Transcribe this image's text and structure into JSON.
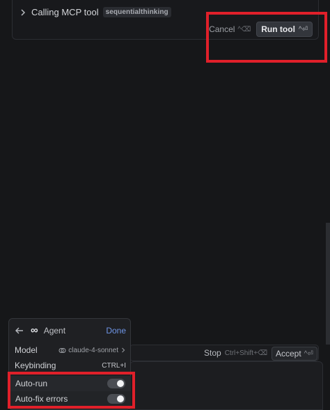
{
  "tool_call": {
    "title": "Calling MCP tool",
    "tool_name": "sequentialthinking",
    "cancel_label": "Cancel",
    "cancel_shortcut": "^⌫",
    "run_label": "Run tool",
    "run_shortcut": "^⏎"
  },
  "composer_bar": {
    "stop_label": "Stop",
    "stop_shortcut": "Ctrl+Shift+⌫",
    "accept_label": "Accept",
    "accept_shortcut": "^⏎"
  },
  "agent_menu": {
    "mode_icon": "∞",
    "mode_label": "Agent",
    "done_label": "Done",
    "model_label": "Model",
    "model_value": "claude-4-sonnet",
    "keybinding_label": "Keybinding",
    "keybinding_value": "CTRL+I",
    "auto_run_label": "Auto-run",
    "auto_run_enabled": true,
    "auto_fix_label": "Auto-fix errors",
    "auto_fix_enabled": true
  },
  "colors": {
    "highlight": "#e0202a",
    "accent_link": "#6f95e6",
    "background": "#161719"
  }
}
